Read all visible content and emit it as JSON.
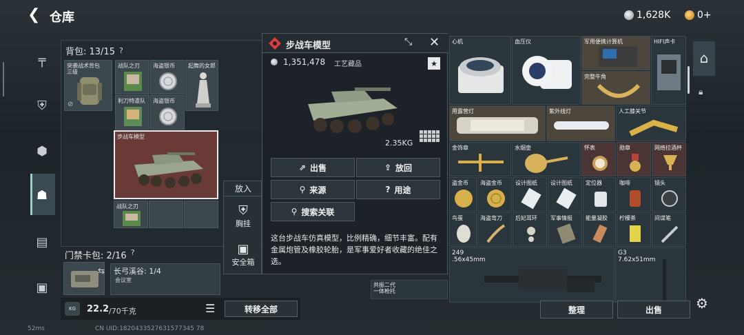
{
  "header": {
    "title": "仓库",
    "coins": "1,628K",
    "gold": "0+"
  },
  "nav": {
    "items": [
      "gun-icon",
      "armor-icon",
      "gear-icon",
      "backpack-icon",
      "clipboard-icon",
      "toolbox-icon"
    ]
  },
  "backpack": {
    "title": "背包: 13/15",
    "help": "?",
    "slots": [
      {
        "label": "突袭战术背包",
        "sub": "三级"
      },
      {
        "label": "战队之刃"
      },
      {
        "label": "海盗银币"
      },
      {
        "label": "起舞的女郎"
      },
      {
        "label": "利刀特遣队"
      },
      {
        "label": "海盗银币"
      },
      {
        "label": "步战车模型"
      },
      {
        "label": "战队之刃"
      }
    ]
  },
  "putin": {
    "title": "放入",
    "items": [
      "胸挂",
      "安全箱"
    ]
  },
  "keycard": {
    "title": "门禁卡包: 2/16",
    "help": "?",
    "item_label": "长弓溪谷: 1/4",
    "sub_label": "会议室"
  },
  "weight": {
    "current": "22.2",
    "max": "/70千克",
    "badge": "KG"
  },
  "transfer_all": "转移全部",
  "detail": {
    "title": "步战车模型",
    "price": "1,351,478",
    "category": "工艺藏品",
    "weight": "2.35KG",
    "actions": {
      "sell": "出售",
      "return": "放回",
      "source": "来源",
      "usage": "用途",
      "search": "搜索关联"
    },
    "description": "这台步战车仿真模型，比例精确，细节丰富。配有金属炮管及橡胶轮胎，是军事爱好者收藏的绝佳之选。"
  },
  "storage": {
    "cells": [
      {
        "label": "心机"
      },
      {
        "label": "血压仪"
      },
      {
        "label": "军用便携计算机"
      },
      {
        "label": "HIFI声卡"
      },
      {
        "label": "完整牛角"
      },
      {
        "label": "用露营灯"
      },
      {
        "label": "紫外线灯"
      },
      {
        "label": "人工膝关节"
      },
      {
        "label": "金饰章"
      },
      {
        "label": "水烟壶"
      },
      {
        "label": "怀表"
      },
      {
        "label": "勋章"
      },
      {
        "label": "网络拉酒杯"
      },
      {
        "label": "盗金币"
      },
      {
        "label": "海盗金币"
      },
      {
        "label": "设计图纸"
      },
      {
        "label": "设计图纸"
      },
      {
        "label": "定位器"
      },
      {
        "label": "咖啡"
      },
      {
        "label": "镜头"
      },
      {
        "label": "鸟蛋"
      },
      {
        "label": "海盗弯刀"
      },
      {
        "label": "后妃耳环"
      },
      {
        "label": "军事情报"
      },
      {
        "label": "能量凝胶"
      },
      {
        "label": "柠檬茶"
      },
      {
        "label": "间谍笔"
      }
    ],
    "weapons": [
      {
        "name": "249",
        "caliber": ".56x45mm"
      },
      {
        "name": "G3",
        "caliber": "7.62x51mm"
      }
    ],
    "bottom_label": "共振二代\n一体枪托"
  },
  "bottom": {
    "sort": "整理",
    "sell": "出售"
  },
  "footer": {
    "ping": "52ms",
    "uid": "CN UID:1820433527631577345 78"
  },
  "colors": {
    "accent": "#e03b3b",
    "selected_bg": "#6a3a36",
    "coin": "#c8ccd0",
    "gold": "#e3a52a"
  }
}
